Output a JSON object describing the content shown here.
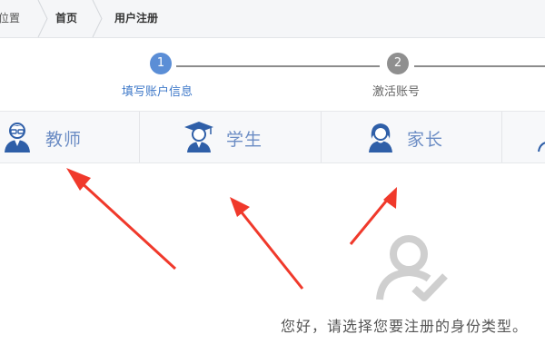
{
  "breadcrumb": {
    "location": "位置",
    "home": "首页",
    "current": "用户注册"
  },
  "steps": [
    {
      "number": "1",
      "label": "填写账户信息",
      "status": "active"
    },
    {
      "number": "2",
      "label": "激活账号",
      "status": "pending"
    }
  ],
  "roles": [
    {
      "label": "教师",
      "icon": "teacher-icon"
    },
    {
      "label": "学生",
      "icon": "student-icon"
    },
    {
      "label": "家长",
      "icon": "parent-icon"
    },
    {
      "label": "",
      "icon": "partial-user-icon"
    }
  ],
  "hint": {
    "icon": "user-check-icon",
    "text": "您好，请选择您要注册的身份类型。"
  },
  "colors": {
    "accent": "#5b8ed6",
    "pending": "#8f8f8f",
    "role_label": "#6b8cc4",
    "annotation_arrow": "#f0392b"
  }
}
